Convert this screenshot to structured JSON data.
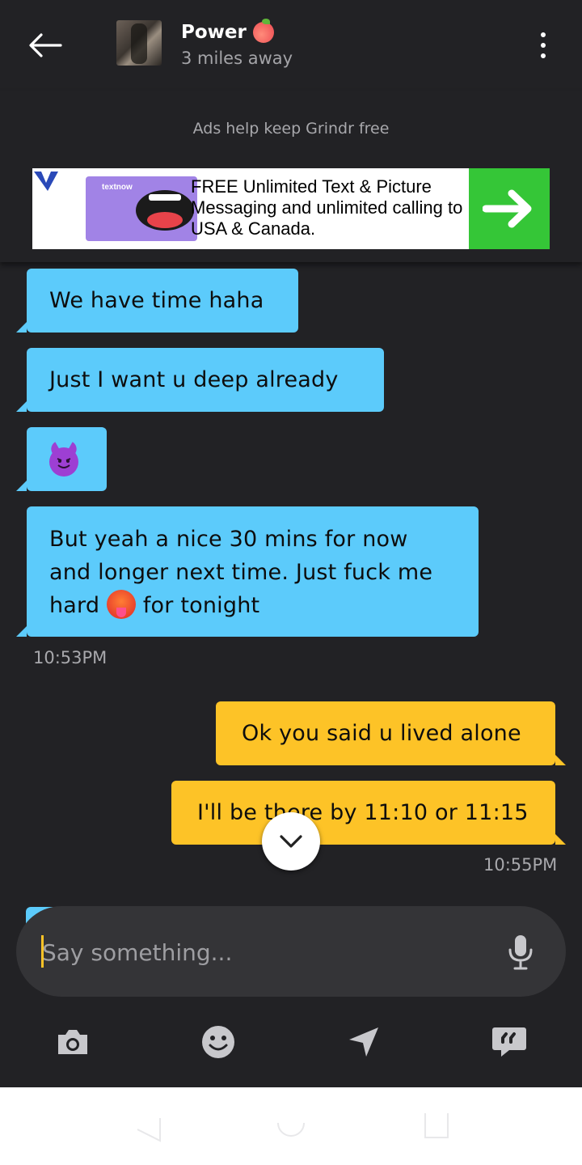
{
  "header": {
    "profile_name": "Power",
    "distance": "3 miles away"
  },
  "ad": {
    "caption": "Ads help keep Grindr free",
    "brand": "textnow",
    "text": "FREE Unlimited Text & Picture Messaging and unlimited calling to USA & Canada."
  },
  "messages": [
    {
      "side": "in",
      "text": "We have time haha"
    },
    {
      "side": "in",
      "text": "Just I want u deep already"
    },
    {
      "side": "in",
      "emoji": "smiling-imp"
    },
    {
      "side": "in",
      "text_before": "But yeah a nice 30 mins for now and longer next time. Just fuck me hard",
      "emoji": "hot-face",
      "text_after": "for tonight"
    },
    {
      "side": "out",
      "text": "Ok you said u lived alone"
    },
    {
      "side": "out",
      "text": "I'll be there by 11:10 or 11:15"
    }
  ],
  "timestamps": {
    "received": "10:53PM",
    "sent": "10:55PM"
  },
  "input": {
    "placeholder": "Say something..."
  },
  "toolbar": [
    "camera-icon",
    "emoji-icon",
    "location-icon",
    "saved-phrases-icon"
  ],
  "colors": {
    "background": "#222225",
    "incoming_bubble": "#5ccbfb",
    "outgoing_bubble": "#fdc327",
    "ad_cta": "#35c637"
  }
}
